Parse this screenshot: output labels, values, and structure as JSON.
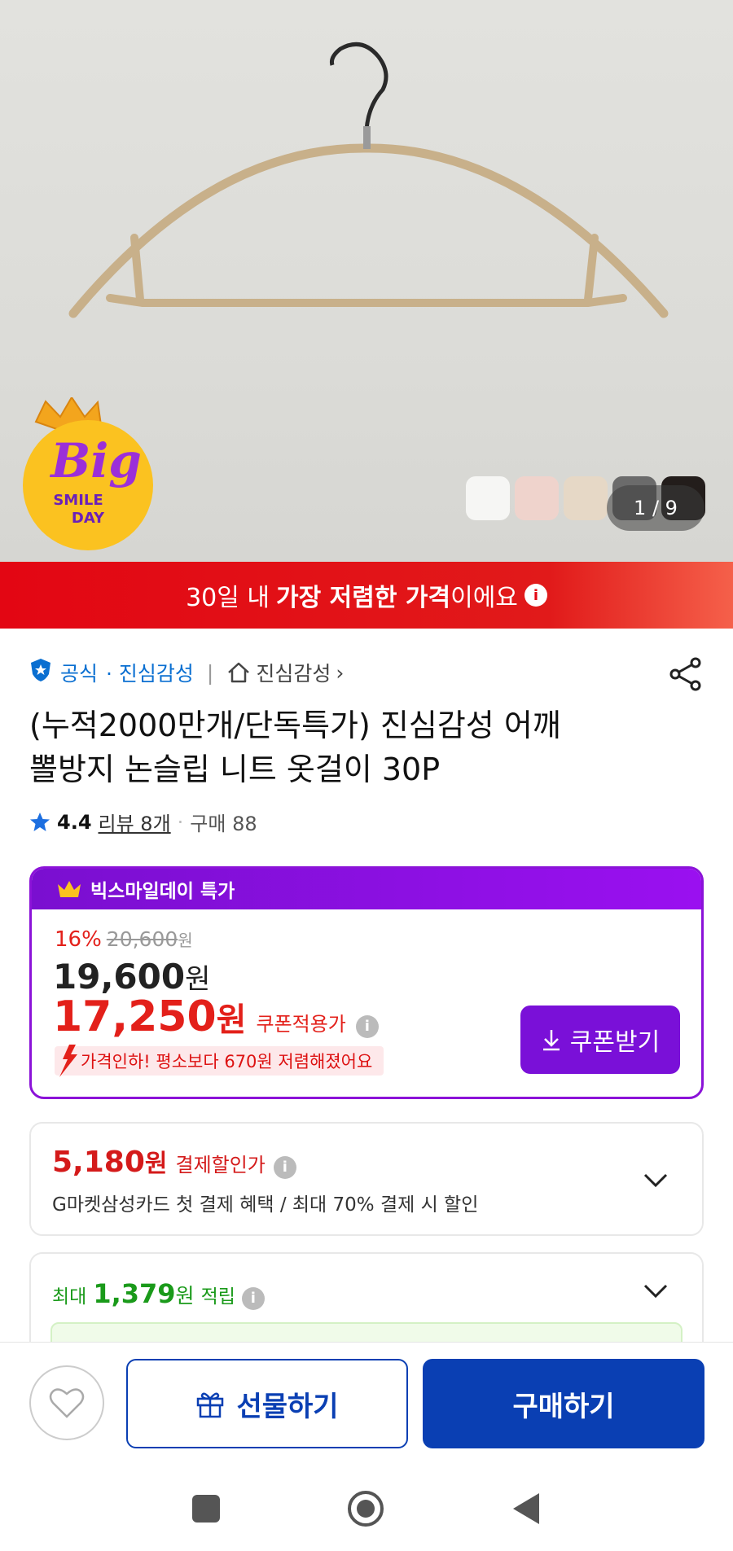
{
  "hero": {
    "image_counter": "1 / 9",
    "promo_badge": {
      "line1": "Big",
      "line2": "SMILE",
      "line3": "DAY"
    },
    "swatch_colors": [
      "#f6f6f4",
      "#efd3cc",
      "#e6d8c6",
      "#6b6b6b",
      "#231d1b"
    ]
  },
  "banner": {
    "prefix": "30일 내 ",
    "bold": "가장 저렴한 가격",
    "suffix": "이에요",
    "info_glyph": "i"
  },
  "seller": {
    "official_label": "공식",
    "brand": "· 진심감성",
    "store_link": "진심감성",
    "store_chevron": "›"
  },
  "product": {
    "title_line1": "(누적2000만개/단독특가) 진심감성 어깨",
    "title_line2": "뽈방지 논슬립 니트 옷걸이 30P",
    "rating": "4.4",
    "review_text": "리뷰 8개",
    "purchase_text": "구매 88"
  },
  "price_box": {
    "header": "빅스마일데이 특가",
    "discount_pct": "16%",
    "original_price": "20,600",
    "original_won": "원",
    "sale_price": "19,600",
    "sale_won": "원",
    "coupon_price": "17,250",
    "coupon_won": "원",
    "coupon_label": "쿠폰적용가",
    "price_cut_text": "가격인하! 평소보다 670원 저렴해졌어요",
    "coupon_button": "쿠폰받기",
    "accent_color": "#7a10d8"
  },
  "payment": {
    "amount": "5,180",
    "won": "원",
    "label": "결제할인가",
    "description": "G마켓삼성카드 첫 결제 혜택 / 최대 70% 결제 시 할인"
  },
  "points": {
    "prefix": "최대",
    "amount": "1,379",
    "won": "원",
    "label": "적립"
  },
  "actions": {
    "gift_label": "선물하기",
    "buy_label": "구매하기",
    "primary_color": "#0a3fb3"
  }
}
